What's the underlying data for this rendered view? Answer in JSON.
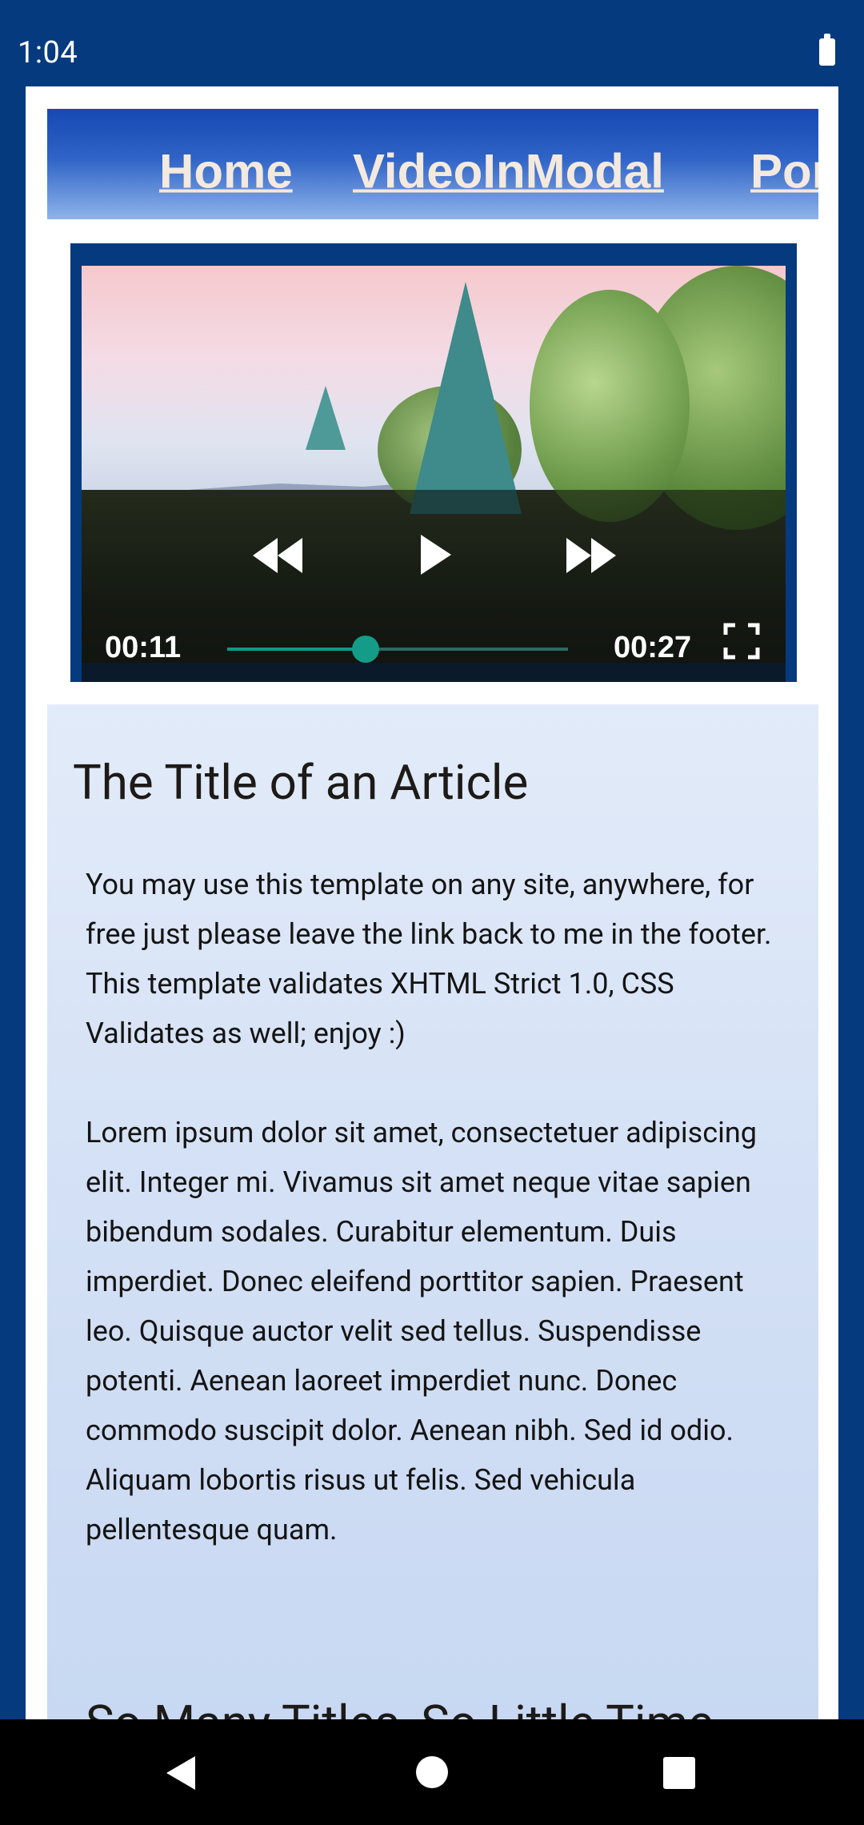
{
  "status_bar": {
    "time": "1:04",
    "battery_icon": "battery-full-icon"
  },
  "nav": {
    "links": [
      {
        "label": "Home"
      },
      {
        "label": "VideoInModal"
      },
      {
        "label": "Portfolio"
      }
    ]
  },
  "video": {
    "current_time": "00:11",
    "duration": "00:27",
    "progress_fraction": 0.407,
    "icons": [
      "rewind-icon",
      "play-icon",
      "fast-forward-icon",
      "fullscreen-icon"
    ],
    "accent": "#149c88"
  },
  "article": {
    "title": "The Title of an Article",
    "paragraph1": "You may use this template on any site, anywhere, for free just please leave the link back to me in the footer. This template validates XHTML Strict 1.0, CSS Validates as well; enjoy :)",
    "paragraph2": "Lorem ipsum dolor sit amet, consectetuer adipiscing elit. Integer mi. Vivamus sit amet neque vitae sapien bibendum sodales. Curabitur elementum. Duis imperdiet. Donec eleifend porttitor sapien. Praesent leo. Quisque auctor velit sed tellus. Suspendisse potenti. Aenean laoreet imperdiet nunc. Donec commodo suscipit dolor. Aenean nibh. Sed id odio. Aliquam lobortis risus ut felis. Sed vehicula pellentesque quam.",
    "subtitle": "So Many Titles, So Little Time"
  },
  "system_nav": {
    "icons": [
      "back-icon",
      "home-icon",
      "recents-icon"
    ]
  },
  "colors": {
    "background": "#063a7f",
    "link": "#f3e9de"
  }
}
